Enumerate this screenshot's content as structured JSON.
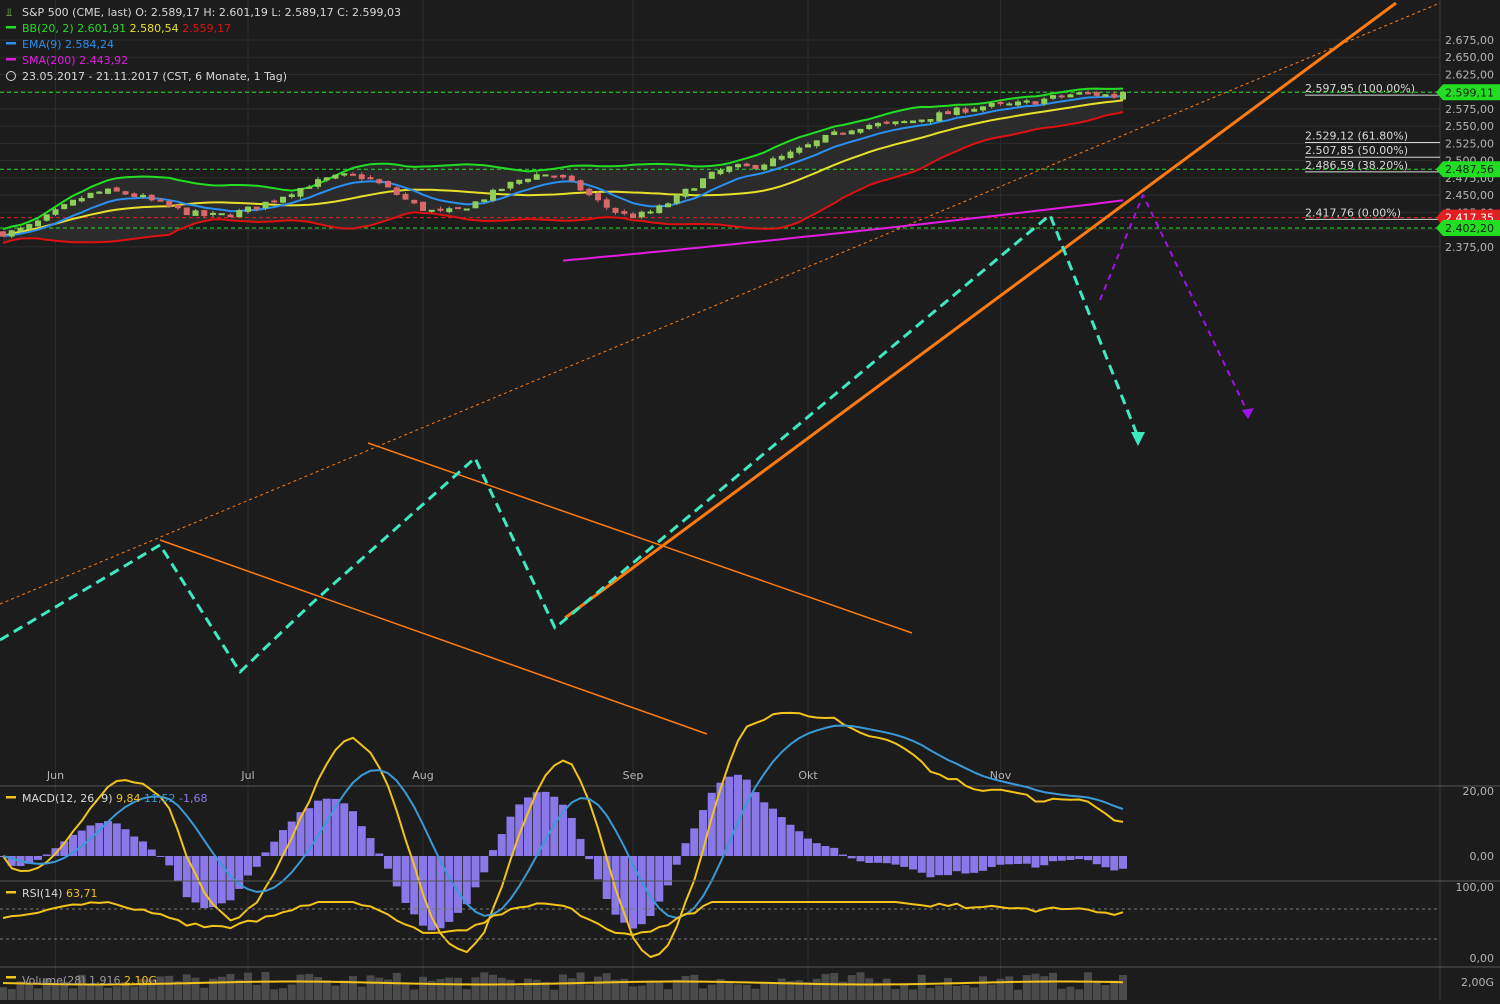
{
  "header": {
    "instrument": "S&P 500 (CME, last)",
    "ohlc": "O: 2.589,17  H: 2.601,19  L: 2.589,17  C: 2.599,03",
    "bb_label": "BB(20, 2)",
    "bb_upper": "2.601,91",
    "bb_middle": "2.580,54",
    "bb_lower": "2.559,17",
    "ema_label": "EMA(9)",
    "ema_value": "2.584,24",
    "sma_label": "SMA(200)",
    "sma_value": "2.443,92",
    "period": "23.05.2017 - 21.11.2017",
    "period_info": "(CST, 6 Monate, 1 Tag)"
  },
  "colors": {
    "background": "#1c1c1c",
    "grid": "#3a3a3a",
    "candle_up": "#8fce58",
    "candle_down": "#d9686b",
    "bb_upper": "#22dd22",
    "bb_lower": "#dd1111",
    "bb_middle": "#e7e02a",
    "ema": "#2a8ff0",
    "sma200": "#e21ce2",
    "trend": "#ff7a10",
    "zigzag": "#3ee8c0",
    "projection_purple": "#a012e8",
    "macd_line": "#f2c31a",
    "macd_signal": "#3b9ad6",
    "macd_hist": "#8a78e8",
    "rsi": "#f2c31a",
    "price_tag_green": "#22dd22",
    "price_tag_red": "#e02020"
  },
  "months": [
    "Jun",
    "Jul",
    "Aug",
    "Sep",
    "Okt",
    "Nov"
  ],
  "price_axis": [
    "2.675,00",
    "2.650,00",
    "2.625,00",
    "2.600,00",
    "2.575,00",
    "2.550,00",
    "2.525,00",
    "2.500,00",
    "2.475,00",
    "2.450,00",
    "2.425,00",
    "2.400,00",
    "2.375,00"
  ],
  "fib_levels": [
    {
      "label": "2.597,95 (100.00%)",
      "price": 2597.95
    },
    {
      "label": "2.529,12 (61.80%)",
      "price": 2529.12
    },
    {
      "label": "2.507,85 (50.00%)",
      "price": 2507.85
    },
    {
      "label": "2.486,59 (38.20%)",
      "price": 2486.59
    },
    {
      "label": "2.417,76 (0.00%)",
      "price": 2417.76
    }
  ],
  "price_tags": [
    {
      "text": "2.599,11",
      "price": 2599.11,
      "color": "green"
    },
    {
      "text": "2.487,56",
      "price": 2487.56,
      "color": "green"
    },
    {
      "text": "2.417,35",
      "price": 2417.35,
      "color": "red"
    },
    {
      "text": "2.402,20",
      "price": 2402.2,
      "color": "green"
    }
  ],
  "macd": {
    "label": "MACD(12, 26, 9)",
    "values": [
      "9,84",
      "11,52",
      "-1,68"
    ],
    "axis": [
      "20,00",
      "0,00"
    ]
  },
  "rsi": {
    "label": "RSI(14)",
    "value": "63,71",
    "axis": [
      "100,00",
      "0,00"
    ]
  },
  "volume": {
    "label": "Volume(28)",
    "value1": "1,916",
    "value2": "2,10G",
    "axis": [
      "2,00G"
    ]
  },
  "chart_data": {
    "type": "candlestick",
    "title": "S&P 500 (CME, last)",
    "period": "23.05.2017 - 21.11.2017",
    "y_range": [
      2355,
      2690
    ],
    "series_approx": {
      "close_anchor_points": [
        [
          0,
          2395
        ],
        [
          12,
          2455
        ],
        [
          24,
          2420
        ],
        [
          40,
          2478
        ],
        [
          50,
          2425
        ],
        [
          62,
          2480
        ],
        [
          72,
          2420
        ],
        [
          84,
          2490
        ],
        [
          100,
          2552
        ],
        [
          114,
          2580
        ],
        [
          124,
          2597
        ],
        [
          128,
          2593
        ]
      ],
      "sma200_endpoints": [
        2355,
        2443.92
      ]
    },
    "last": {
      "open": 2589.17,
      "high": 2601.19,
      "low": 2589.17,
      "close": 2599.03
    }
  }
}
